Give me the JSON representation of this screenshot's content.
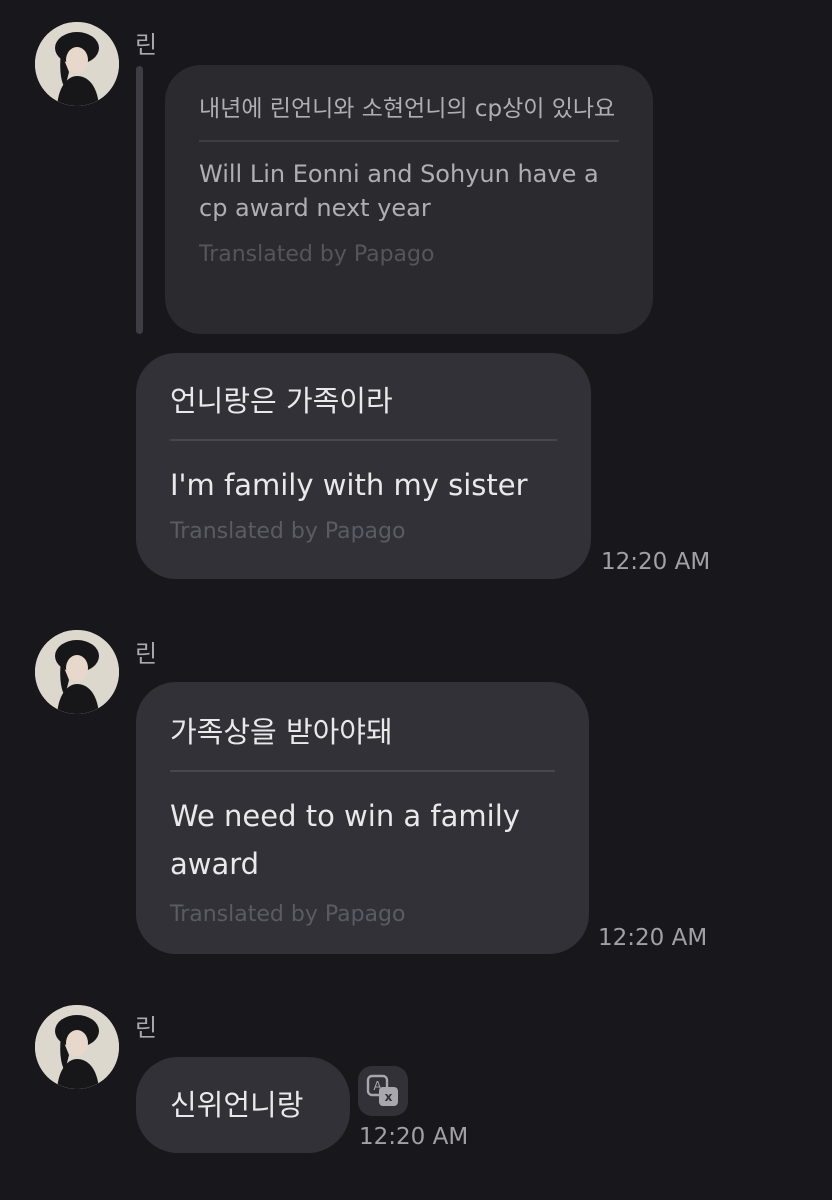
{
  "messages": [
    {
      "sender": "린",
      "quoted": {
        "original": "내년에 린언니와 소현언니의 cp상이 있나요",
        "translation": "Will Lin Eonni and Sohyun have a cp award next year",
        "credit": "Translated by Papago"
      },
      "original": "언니랑은 가족이라",
      "translation": "I'm family with my sister",
      "credit": "Translated by Papago",
      "time": "12:20 AM"
    },
    {
      "sender": "린",
      "original": "가족상을 받아야돼",
      "translation": "We need to win a family award",
      "credit": "Translated by Papago",
      "time": "12:20 AM"
    },
    {
      "sender": "린",
      "original": "신위언니랑",
      "time": "12:20 AM",
      "translate_icon": "translate-icon"
    }
  ],
  "colors": {
    "background": "#18181c",
    "bubble": "#313137",
    "quoted_bubble": "#2a2a2f",
    "text": "#e9e9ec",
    "muted": "#a0a0a6",
    "credit": "#5b5b63"
  }
}
